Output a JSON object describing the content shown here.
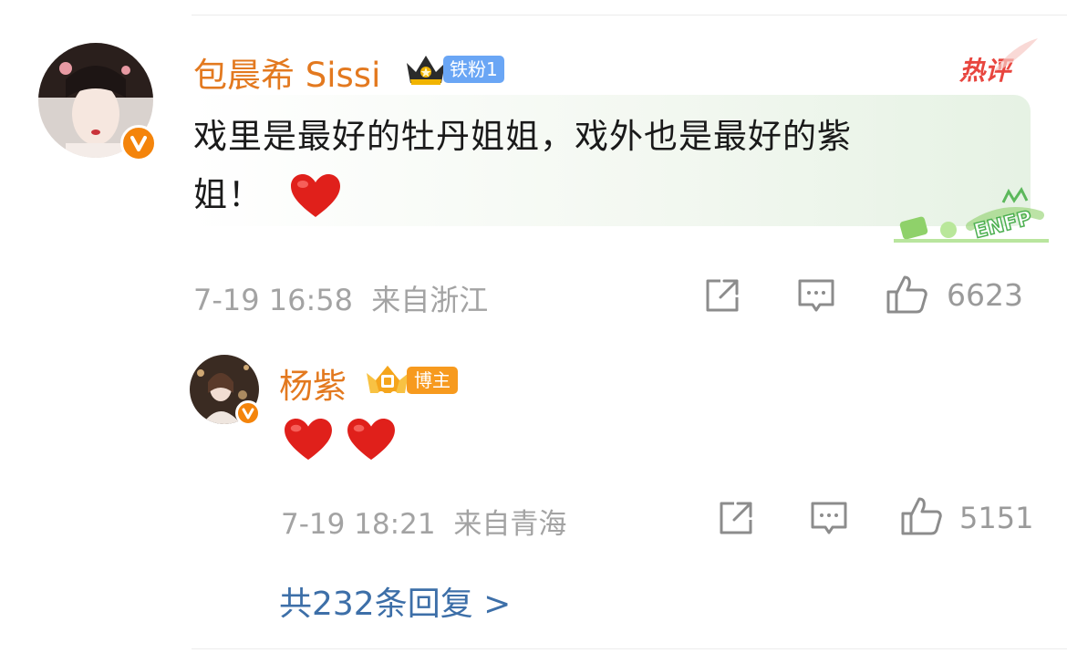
{
  "comment": {
    "username": "包晨希 Sissi",
    "fan_badge_label": "铁粉1",
    "hot_tag": "热评",
    "text_line1": "戏里是最好的牡丹姐姐，戏外也是最好的紫",
    "text_line2": "姐！",
    "timestamp": "7-19 16:58",
    "location": "来自浙江",
    "like_count": "6623",
    "stamp_text": "ENFP"
  },
  "reply": {
    "username": "杨紫",
    "badge_label": "博主",
    "timestamp": "7-19 18:21",
    "location": "来自青海",
    "like_count": "5151"
  },
  "replies_link": "共232条回复 >",
  "icons": {
    "share": "share-icon",
    "comment": "comment-icon",
    "like": "thumbs-up-icon",
    "verified": "verified-v-icon",
    "heart": "red-heart-emoji",
    "crown": "crown-icon"
  },
  "colors": {
    "username": "#e3791f",
    "fan_badge": "#6aa6f5",
    "blogger_badge": "#f79a1e",
    "hot_tag": "#e8463f",
    "link": "#3d6fa8",
    "meta": "#a3a3a3",
    "heart": "#e0201b"
  }
}
